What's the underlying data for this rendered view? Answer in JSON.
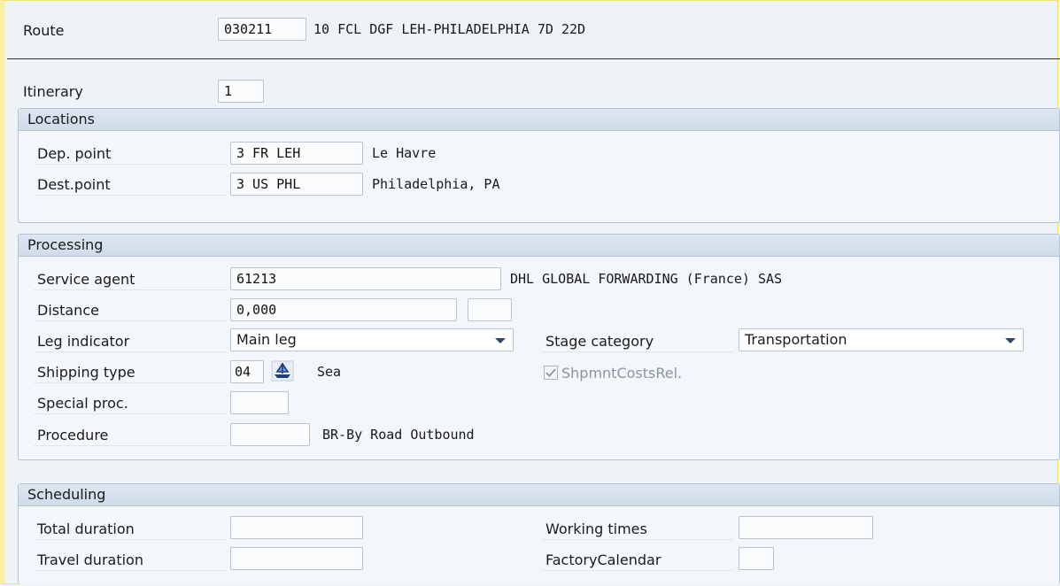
{
  "header": {
    "route_label": "Route",
    "route_value": "030211",
    "route_desc": "10 FCL DGF LEH-PHILADELPHIA 7D 22D",
    "itinerary_label": "Itinerary",
    "itinerary_value": "1"
  },
  "locations": {
    "title": "Locations",
    "dep_label": "Dep. point",
    "dep_value": "3 FR LEH",
    "dep_name": "Le Havre",
    "dest_label": "Dest.point",
    "dest_value": "3 US PHL",
    "dest_name": "Philadelphia, PA"
  },
  "processing": {
    "title": "Processing",
    "service_agent_label": "Service agent",
    "service_agent_value": "61213",
    "service_agent_name": "DHL GLOBAL FORWARDING (France) SAS",
    "distance_label": "Distance",
    "distance_value": "0,000",
    "distance_unit": "",
    "leg_label": "Leg indicator",
    "leg_value": "Main leg",
    "stage_label": "Stage category",
    "stage_value": "Transportation",
    "shipping_label": "Shipping type",
    "shipping_value": "04",
    "shipping_icon": "ship-icon",
    "shipping_name": "Sea",
    "costs_label": "ShpmntCostsRel.",
    "costs_checked": true,
    "special_label": "Special proc.",
    "special_value": "",
    "procedure_label": "Procedure",
    "procedure_value": "",
    "procedure_desc": "BR-By Road Outbound"
  },
  "scheduling": {
    "title": "Scheduling",
    "total_label": "Total duration",
    "total_value": "",
    "travel_label": "Travel duration",
    "travel_value": "",
    "working_label": "Working times",
    "working_value": "",
    "calendar_label": "FactoryCalendar",
    "calendar_value": ""
  }
}
